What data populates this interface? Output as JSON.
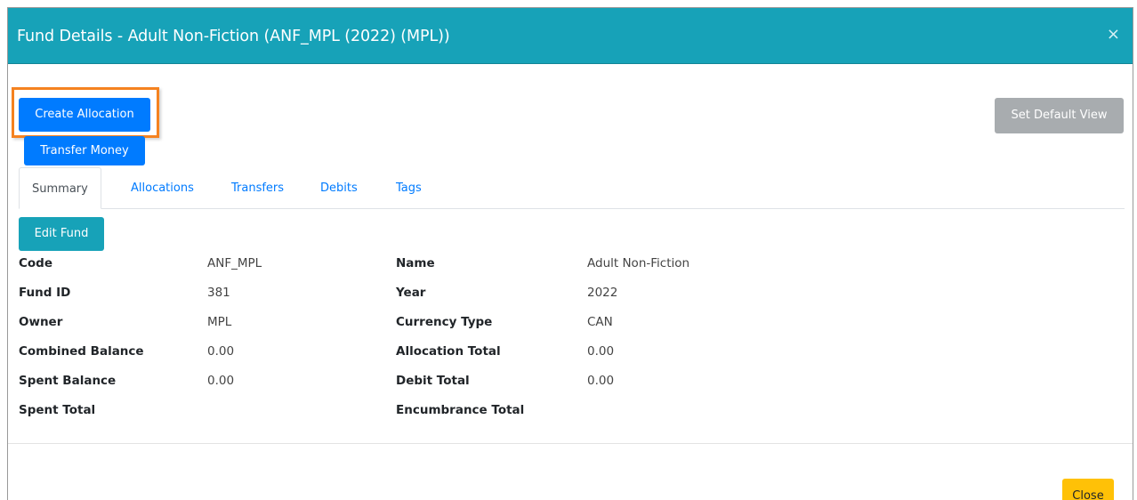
{
  "modal": {
    "title": "Fund Details - Adult Non-Fiction (ANF_MPL (2022) (MPL))",
    "close_symbol": "×"
  },
  "actions": {
    "create_allocation": "Create Allocation",
    "transfer_money": "Transfer Money",
    "set_default_view": "Set Default View",
    "edit_fund": "Edit Fund",
    "close": "Close"
  },
  "tabs": [
    {
      "label": "Summary",
      "active": true
    },
    {
      "label": "Allocations",
      "active": false
    },
    {
      "label": "Transfers",
      "active": false
    },
    {
      "label": "Debits",
      "active": false
    },
    {
      "label": "Tags",
      "active": false
    }
  ],
  "fields": {
    "left": [
      {
        "label": "Code",
        "value": "ANF_MPL"
      },
      {
        "label": "Fund ID",
        "value": "381"
      },
      {
        "label": "Owner",
        "value": "MPL"
      },
      {
        "label": "Combined Balance",
        "value": "0.00"
      },
      {
        "label": "Spent Balance",
        "value": "0.00"
      },
      {
        "label": "Spent Total",
        "value": ""
      }
    ],
    "right": [
      {
        "label": "Name",
        "value": "Adult Non-Fiction"
      },
      {
        "label": "Year",
        "value": "2022"
      },
      {
        "label": "Currency Type",
        "value": "CAN"
      },
      {
        "label": "Allocation Total",
        "value": "0.00"
      },
      {
        "label": "Debit Total",
        "value": "0.00"
      },
      {
        "label": "Encumbrance Total",
        "value": ""
      }
    ]
  },
  "colors": {
    "header": "#17a2b8",
    "primary": "#007bff",
    "highlight": "#f58220",
    "warning": "#ffc107",
    "secondary": "#a8acaf"
  }
}
